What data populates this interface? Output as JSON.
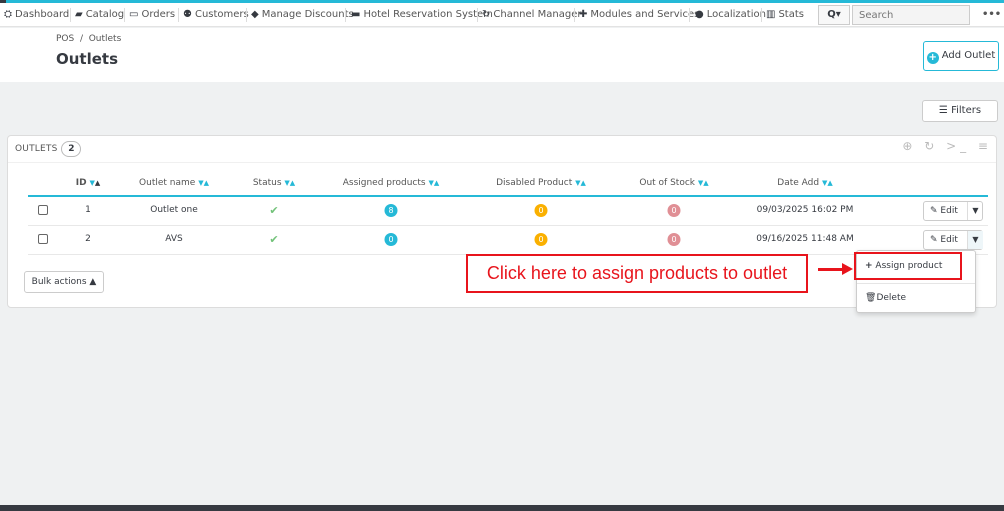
{
  "nav": {
    "items": [
      {
        "label": "Dashboard",
        "icon": "dashboard-icon",
        "glyph": "⛭"
      },
      {
        "label": "Catalog",
        "icon": "book-icon",
        "glyph": "▰"
      },
      {
        "label": "Orders",
        "icon": "credit-card-icon",
        "glyph": "▭"
      },
      {
        "label": "Customers",
        "icon": "users-icon",
        "glyph": "⚉"
      },
      {
        "label": "Manage Discounts",
        "icon": "tag-icon",
        "glyph": "◆"
      },
      {
        "label": "Hotel Reservation System",
        "icon": "bed-icon",
        "glyph": "▬"
      },
      {
        "label": "Channel Manager",
        "icon": "refresh-icon",
        "glyph": "↻"
      },
      {
        "label": "Modules and Services",
        "icon": "puzzle-icon",
        "glyph": "✚"
      },
      {
        "label": "Localization",
        "icon": "globe-icon",
        "glyph": "●"
      },
      {
        "label": "Stats",
        "icon": "bar-chart-icon",
        "glyph": "▥"
      }
    ],
    "search_button": "Q▾",
    "search_placeholder": "Search",
    "more": "•••"
  },
  "header": {
    "breadcrumb": "POS  /  Outlets",
    "title": "Outlets",
    "add_button": "Add Outlet"
  },
  "filters_label": "Filters",
  "panel": {
    "title": "OUTLETS",
    "count": "2",
    "tools": "⊕ ↻ >_ ≡"
  },
  "table": {
    "columns": [
      "ID",
      "Outlet name",
      "Status",
      "Assigned products",
      "Disabled Product",
      "Out of Stock",
      "Date Add"
    ],
    "rows": [
      {
        "id": "1",
        "name": "Outlet one",
        "assigned": "8",
        "disabled": "0",
        "out_of_stock": "0",
        "date": "09/03/2025 16:02 PM",
        "edit": "Edit"
      },
      {
        "id": "2",
        "name": "AVS",
        "assigned": "0",
        "disabled": "0",
        "out_of_stock": "0",
        "date": "09/16/2025 11:48 AM",
        "edit": "Edit"
      }
    ]
  },
  "bulk_actions": "Bulk actions",
  "dropdown": {
    "assign": "Assign product",
    "delete": "Delete"
  },
  "callout": "Click here to assign products to outlet",
  "colors": {
    "accent": "#25b9d7",
    "callout": "#e8141c",
    "status_ok": "#72c279",
    "badge_info": "#25b9d7",
    "badge_warning": "#fab000",
    "badge_danger": "#e08f95"
  }
}
